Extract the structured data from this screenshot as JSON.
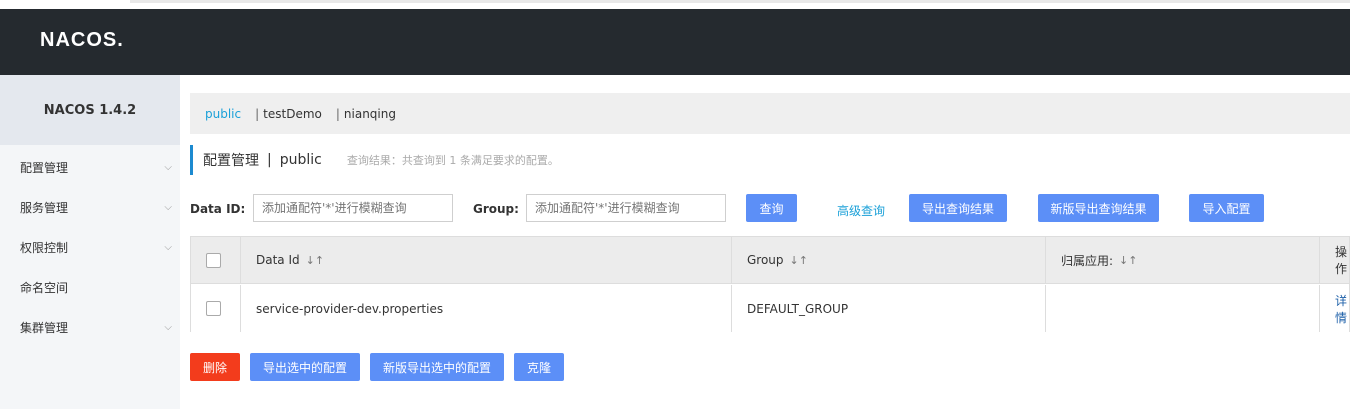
{
  "header": {
    "logo": "NACOS."
  },
  "sidebar": {
    "version": "NACOS 1.4.2",
    "items": [
      {
        "label": "配置管理",
        "expandable": true
      },
      {
        "label": "服务管理",
        "expandable": true
      },
      {
        "label": "权限控制",
        "expandable": true
      },
      {
        "label": "命名空间",
        "expandable": false
      },
      {
        "label": "集群管理",
        "expandable": true
      }
    ],
    "chevron": "⌵"
  },
  "namespaces": {
    "items": [
      "public",
      "testDemo",
      "nianqing"
    ],
    "separator": "|",
    "active": "public"
  },
  "page_title": {
    "title": "配置管理",
    "sep": "|",
    "namespace": "public",
    "result": "查询结果：共查询到 1 条满足要求的配置。"
  },
  "filters": {
    "data_id_label": "Data ID:",
    "data_id_placeholder": "添加通配符'*'进行模糊查询",
    "group_label": "Group:",
    "group_placeholder": "添加通配符'*'进行模糊查询"
  },
  "toolbar": {
    "query": "查询",
    "advanced_query": "高级查询",
    "export_results": "导出查询结果",
    "new_export_results": "新版导出查询结果",
    "import_config": "导入配置"
  },
  "table": {
    "sort_icon": "↓↑",
    "columns": [
      "Data Id",
      "Group",
      "归属应用:",
      "操作"
    ],
    "rows": [
      {
        "data_id": "service-provider-dev.properties",
        "group": "DEFAULT_GROUP",
        "app": "",
        "action": "详情"
      }
    ]
  },
  "bottom_actions": {
    "delete": "删除",
    "export_selected": "导出选中的配置",
    "new_export_selected": "新版导出选中的配置",
    "clone": "克隆"
  },
  "colors": {
    "header_bg": "#252a2f",
    "primary": "#5c8ff7",
    "danger": "#f33c1c",
    "link": "#1aa0d8"
  }
}
